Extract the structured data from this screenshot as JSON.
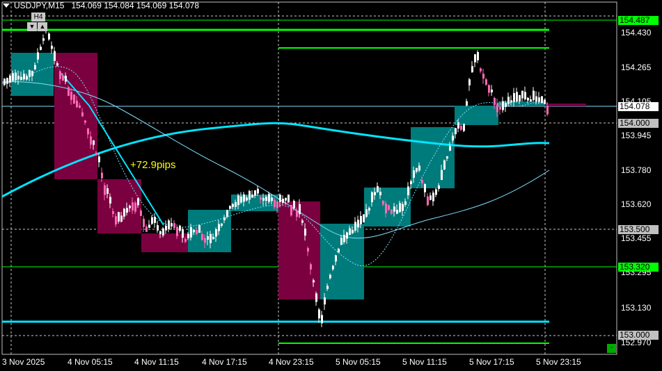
{
  "header": {
    "symbol_tf": "USDJPY,M15",
    "ohlc": "154.069 154.084 154.069 154.078"
  },
  "overlay": {
    "tf_label": "H4",
    "down_icon": "▼",
    "up_icon": "▲"
  },
  "annotation": {
    "pips": "+72.9pips"
  },
  "price_axis": {
    "ticks": [
      "154.430",
      "154.265",
      "154.105",
      "153.945",
      "153.780",
      "153.620",
      "153.455",
      "153.295",
      "153.130",
      "152.970"
    ]
  },
  "price_labels": [
    {
      "name": "green-level-top",
      "text": "154.487",
      "bg": "#00ff00",
      "fg": "#000000"
    },
    {
      "name": "current-price",
      "text": "154.078",
      "bg": "#ffffff",
      "fg": "#000000"
    },
    {
      "name": "level-154000",
      "text": "154.000",
      "bg": "#c0c0c0",
      "fg": "#000000"
    },
    {
      "name": "level-153500",
      "text": "153.500",
      "bg": "#c0c0c0",
      "fg": "#000000"
    },
    {
      "name": "green-level-mid",
      "text": "153.320",
      "bg": "#00ff00",
      "fg": "#000000"
    },
    {
      "name": "level-153000",
      "text": "153.000",
      "bg": "#c0c0c0",
      "fg": "#000000"
    }
  ],
  "time_axis": {
    "labels": [
      "3 Nov 2025",
      "4 Nov 05:15",
      "4 Nov 11:15",
      "4 Nov 17:15",
      "4 Nov 23:15",
      "5 Nov 05:15",
      "5 Nov 11:15",
      "5 Nov 17:15",
      "5 Nov 23:15"
    ]
  },
  "mini_button": "-",
  "colors": {
    "bull": "#007b7b",
    "bear": "#7b0040",
    "candle_up": "#ffffff",
    "candle_down": "#ff69b4",
    "green_line": "#00ff00",
    "cyan_line": "#00e5ff",
    "ma_light": "#7fe0ff"
  }
}
